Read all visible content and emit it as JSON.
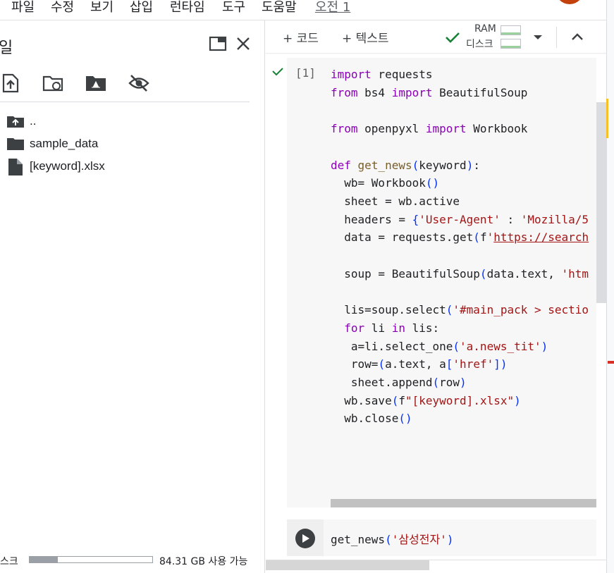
{
  "menu": {
    "items": [
      "파일",
      "수정",
      "보기",
      "삽입",
      "런타임",
      "도구",
      "도움말"
    ],
    "clock": "오전 1"
  },
  "file_panel": {
    "title": "일",
    "tree": [
      {
        "label": "..",
        "icon": "folder-up-icon"
      },
      {
        "label": "sample_data",
        "icon": "folder-icon"
      },
      {
        "label": "[keyword].xlsx",
        "icon": "file-icon"
      }
    ],
    "disk_label": "스크",
    "disk_used_fraction": 0.23,
    "disk_free": "84.31 GB 사용 가능"
  },
  "toolbar": {
    "add_code": "+ 코드",
    "add_text": "+ 텍스트",
    "ram_label": "RAM",
    "disk_label": "디스크"
  },
  "cell1": {
    "execution_count": "[1]",
    "lines": [
      "import requests",
      "from bs4 import BeautifulSoup",
      "",
      "from openpyxl import Workbook",
      "",
      "def get_news(keyword):",
      "  wb= Workbook()",
      "  sheet = wb.active",
      "  headers = {'User-Agent' : 'Mozilla/5",
      "  data = requests.get(f'https://search",
      "",
      "  soup = BeautifulSoup(data.text, 'htm",
      "",
      "  lis=soup.select('#main_pack > sectio",
      "  for li in lis:",
      "   a=li.select_one('a.news_tit')",
      "   row=(a.text, a['href'])",
      "   sheet.append(row)",
      "  wb.save(f\"[keyword].xlsx\")",
      "  wb.close()"
    ]
  },
  "cell2": {
    "code": "get_news('삼성전자')"
  },
  "colors": {
    "keyword": "#8b00b5",
    "string": "#a31515",
    "check": "#188038"
  }
}
